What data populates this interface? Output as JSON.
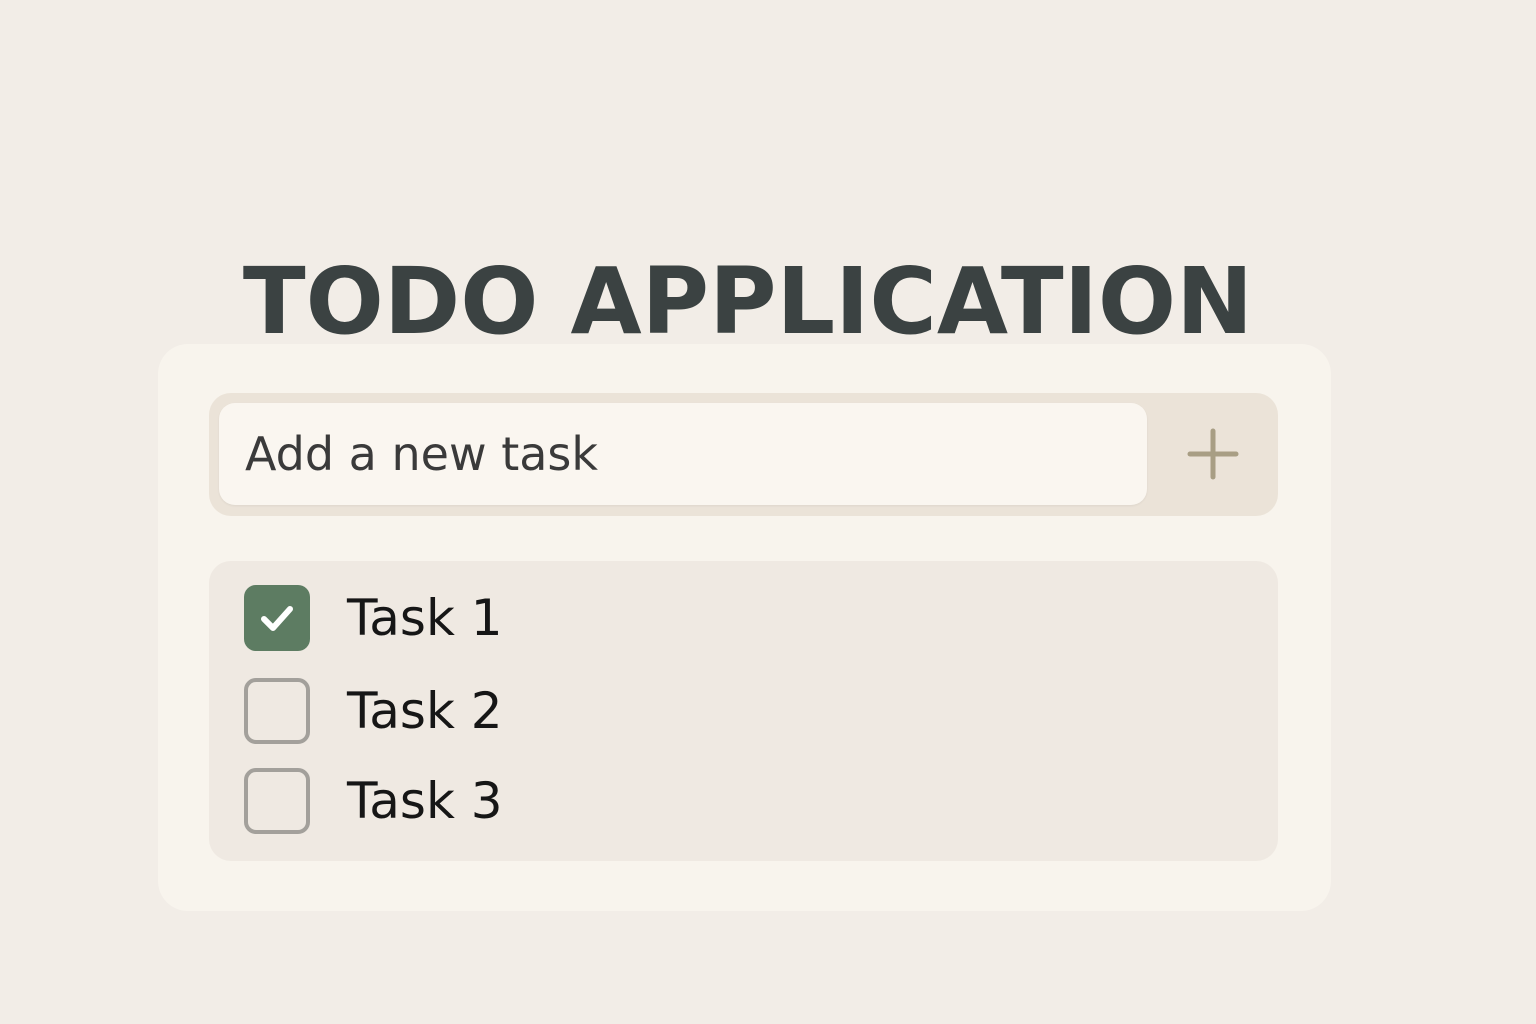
{
  "app": {
    "title": "TODO APPLICATION"
  },
  "composer": {
    "placeholder": "Add a new task",
    "value": "",
    "add_icon": "plus-icon"
  },
  "tasks": [
    {
      "label": "Task 1",
      "checked": true
    },
    {
      "label": "Task 2",
      "checked": false
    },
    {
      "label": "Task 3",
      "checked": false
    }
  ],
  "colors": {
    "background": "#f2ede7",
    "card": "#f8f4ed",
    "accent_checked": "#5d7c62",
    "checkbox_border": "#a3a09b",
    "title_text": "#3b4242",
    "plus_icon": "#a89e84"
  }
}
